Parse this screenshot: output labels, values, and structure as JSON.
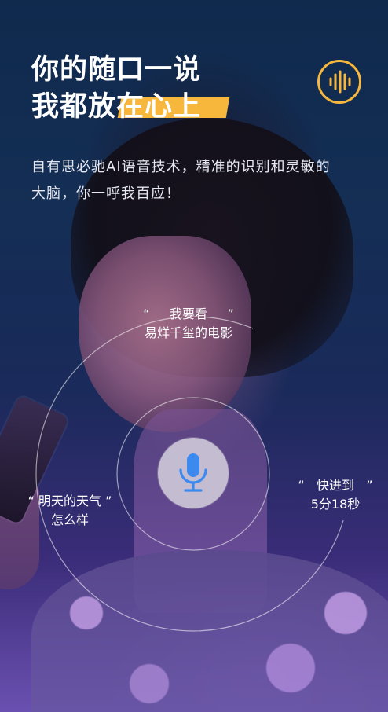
{
  "headline": {
    "line1": "你的随口一说",
    "line2": "我都放在心上"
  },
  "description": {
    "line1": "自有思必驰AI语音技术，精准的识别和灵敏的",
    "line2": "大脑，你一呼我百应！"
  },
  "examples": [
    {
      "open_quote": "“",
      "line1": "我要看",
      "close_quote": "”",
      "line2": "易烊千玺的电影"
    },
    {
      "open_quote": "“",
      "line1": "明天的天气",
      "close_quote": "”",
      "line2": "怎么样"
    },
    {
      "open_quote": "“",
      "line1": "快进到",
      "close_quote": "”",
      "line2": "5分18秒"
    }
  ],
  "icons": {
    "voice_wave": "sound-wave-icon",
    "mic": "microphone-icon"
  },
  "colors": {
    "accent": "#f6b73c",
    "mic_blue": "#3c8af0",
    "text": "#ffffff"
  }
}
